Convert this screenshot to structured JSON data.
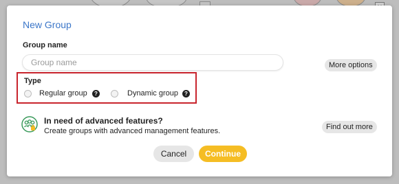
{
  "background": {
    "close_glyph": "✕"
  },
  "dialog": {
    "title": "New Group",
    "group_name": {
      "label": "Group name",
      "placeholder": "Group name",
      "value": ""
    },
    "more_options_label": "More options",
    "type": {
      "label": "Type",
      "options": [
        {
          "label": "Regular group",
          "selected": false,
          "help_icon": "question-circle-icon"
        },
        {
          "label": "Dynamic group",
          "selected": false,
          "help_icon": "question-circle-icon"
        }
      ],
      "help_glyph": "?"
    },
    "advanced": {
      "icon": "group-advanced-icon",
      "title": "In need of advanced features?",
      "subtitle": "Create groups with advanced management features.",
      "button_label": "Find out more"
    },
    "actions": {
      "cancel_label": "Cancel",
      "continue_label": "Continue"
    }
  },
  "colors": {
    "title": "#3b76c8",
    "continue_button": "#f5bd24",
    "highlight_box": "#c8232c",
    "advanced_icon": "#3a9a5b"
  }
}
